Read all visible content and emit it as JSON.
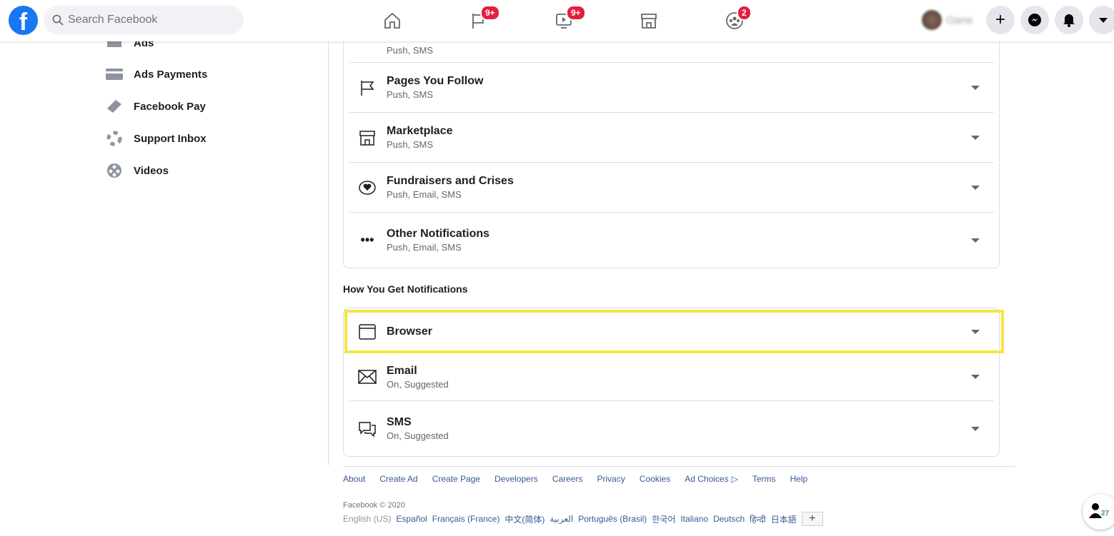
{
  "header": {
    "logo": "f",
    "search_placeholder": "Search Facebook",
    "badges": {
      "pages": "9+",
      "watch": "9+",
      "groups": "2"
    },
    "user_name": "Oana"
  },
  "sidebar": {
    "items": [
      {
        "label": "Ads",
        "icon": "ads-icon"
      },
      {
        "label": "Ads Payments",
        "icon": "credit-card-icon"
      },
      {
        "label": "Facebook Pay",
        "icon": "facebook-pay-icon"
      },
      {
        "label": "Support Inbox",
        "icon": "lifebuoy-icon"
      },
      {
        "label": "Videos",
        "icon": "film-reel-icon"
      }
    ]
  },
  "what_notifications": {
    "rows": [
      {
        "title": "",
        "sub": "Push, SMS",
        "icon": "partial-icon"
      },
      {
        "title": "Pages You Follow",
        "sub": "Push, SMS",
        "icon": "flag-icon"
      },
      {
        "title": "Marketplace",
        "sub": "Push, SMS",
        "icon": "shop-icon"
      },
      {
        "title": "Fundraisers and Crises",
        "sub": "Push, Email, SMS",
        "icon": "heart-coin-icon"
      },
      {
        "title": "Other Notifications",
        "sub": "Push, Email, SMS",
        "icon": "more-dots-icon"
      }
    ]
  },
  "how_heading": "How You Get Notifications",
  "how_notifications": {
    "rows": [
      {
        "title": "Browser",
        "sub": "",
        "icon": "browser-window-icon"
      },
      {
        "title": "Email",
        "sub": "On, Suggested",
        "icon": "envelope-icon"
      },
      {
        "title": "SMS",
        "sub": "On, Suggested",
        "icon": "chat-bubbles-icon"
      }
    ]
  },
  "highlight_color": "#f5e642",
  "footer": {
    "links": [
      "About",
      "Create Ad",
      "Create Page",
      "Developers",
      "Careers",
      "Privacy",
      "Cookies",
      "Ad Choices",
      "Terms",
      "Help"
    ],
    "copyright": "Facebook © 2020",
    "languages": [
      "English (US)",
      "Español",
      "Français (France)",
      "中文(简体)",
      "العربية",
      "Português (Brasil)",
      "한국어",
      "Italiano",
      "Deutsch",
      "हिन्दी",
      "日本語"
    ],
    "more_languages": "+"
  },
  "contacts_count": "27"
}
